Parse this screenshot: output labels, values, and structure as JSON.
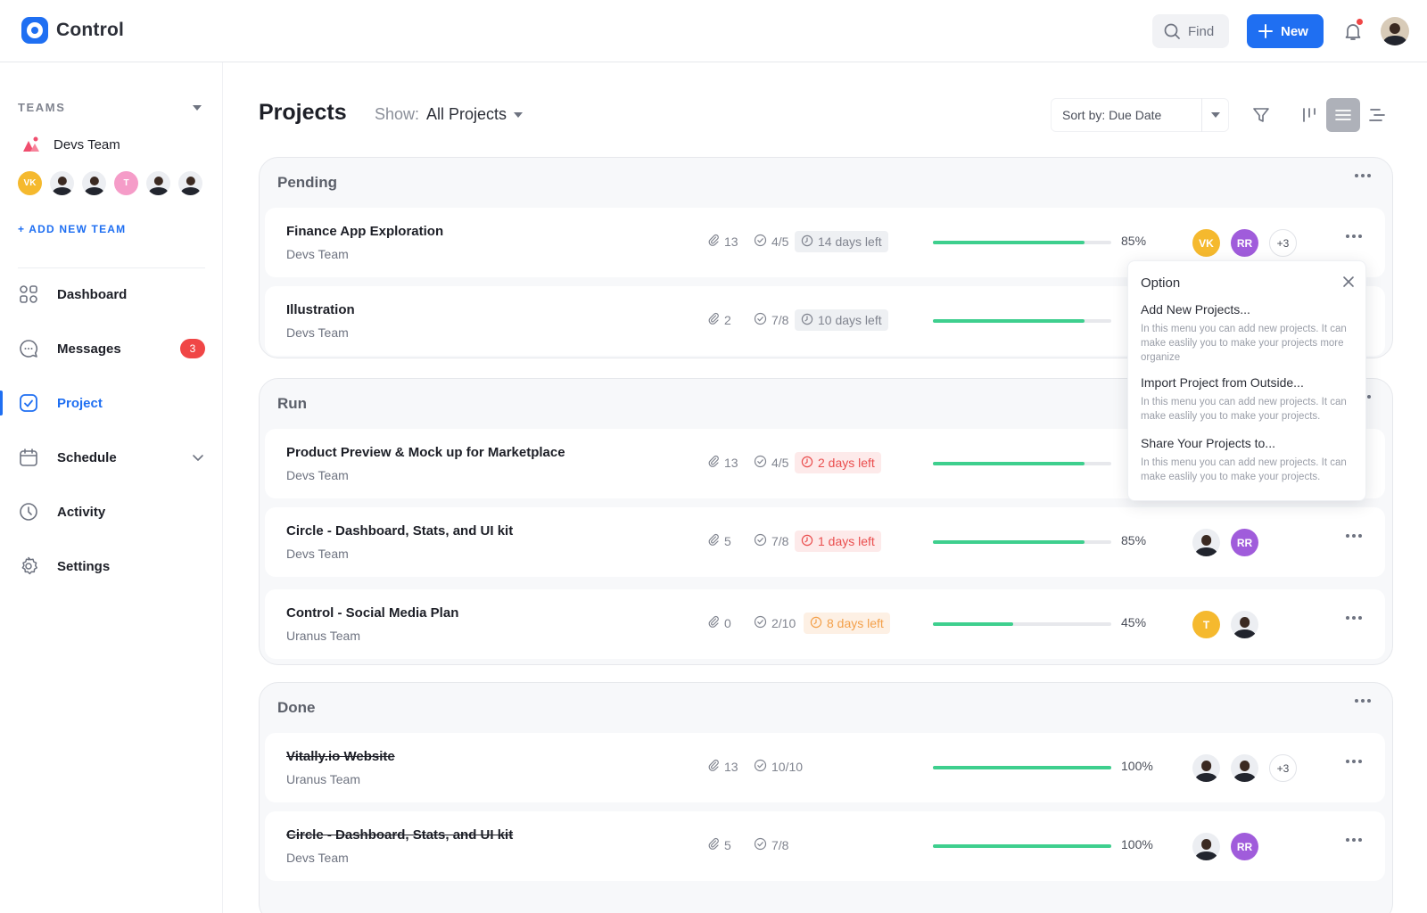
{
  "app": {
    "name": "Control"
  },
  "topbar": {
    "find_label": "Find",
    "new_label": "New"
  },
  "sidebar": {
    "teams_label": "TEAMS",
    "team_name": "Devs Team",
    "team_avatars": [
      {
        "type": "initials",
        "text": "VK",
        "color": "#f5b92e"
      },
      {
        "type": "photo"
      },
      {
        "type": "photo"
      },
      {
        "type": "initials",
        "text": "T",
        "color": "#f59cc8"
      },
      {
        "type": "photo"
      },
      {
        "type": "photo"
      }
    ],
    "add_team_label": "+ ADD NEW TEAM",
    "nav": [
      {
        "label": "Dashboard",
        "icon": "dashboard-icon"
      },
      {
        "label": "Messages",
        "icon": "chat-icon",
        "badge": "3"
      },
      {
        "label": "Project",
        "icon": "check-square-icon",
        "active": true
      },
      {
        "label": "Schedule",
        "icon": "calendar-icon",
        "has_chevron": true
      },
      {
        "label": "Activity",
        "icon": "clock-icon"
      },
      {
        "label": "Settings",
        "icon": "gear-icon"
      }
    ]
  },
  "main": {
    "title": "Projects",
    "show_label": "Show:",
    "show_value": "All Projects",
    "sort_label": "Sort by:",
    "sort_value": "Due Date"
  },
  "colors": {
    "accent": "#1f6ff2",
    "progress": "#3ecf8e",
    "danger": "#f04646",
    "avatar_vk": "#f5b92e",
    "avatar_rr": "#a05cdb",
    "avatar_t": "#f5b92e"
  },
  "sections": [
    {
      "title": "Pending",
      "rows": [
        {
          "title": "Finance App Exploration",
          "team": "Devs Team",
          "attachments": "13",
          "tasks": "4/5",
          "deadline": "14 days left",
          "deadline_style": "gray",
          "progress": 0.85,
          "percent": "85%",
          "avatars": [
            "VK",
            "RR",
            "+3"
          ],
          "done": false
        },
        {
          "title": "Illustration",
          "team": "Devs Team",
          "attachments": "2",
          "tasks": "7/8",
          "deadline": "10 days left",
          "deadline_style": "gray",
          "progress": 0.85,
          "percent": "",
          "avatars": [],
          "done": false
        }
      ]
    },
    {
      "title": "Run",
      "rows": [
        {
          "title": "Product Preview & Mock up for Marketplace",
          "team": "Devs Team",
          "attachments": "13",
          "tasks": "4/5",
          "deadline": "2 days left",
          "deadline_style": "red",
          "progress": 0.85,
          "percent": "",
          "avatars": [],
          "done": false
        },
        {
          "title": "Circle - Dashboard, Stats, and UI kit",
          "team": "Devs Team",
          "attachments": "5",
          "tasks": "7/8",
          "deadline": "1 days left",
          "deadline_style": "red",
          "progress": 0.85,
          "percent": "85%",
          "avatars": [
            "photo",
            "RR"
          ],
          "done": false
        },
        {
          "title": "Control - Social Media Plan",
          "team": "Uranus Team",
          "attachments": "0",
          "tasks": "2/10",
          "deadline": "8 days left",
          "deadline_style": "orange",
          "progress": 0.45,
          "percent": "45%",
          "avatars": [
            "T",
            "photo"
          ],
          "done": false
        }
      ]
    },
    {
      "title": "Done",
      "rows": [
        {
          "title": "Vitally.io Website",
          "team": "Uranus Team",
          "attachments": "13",
          "tasks": "10/10",
          "deadline": "",
          "deadline_style": "",
          "progress": 1.0,
          "percent": "100%",
          "avatars": [
            "photo",
            "photo",
            "+3"
          ],
          "done": true
        },
        {
          "title": "Circle - Dashboard, Stats, and UI kit",
          "team": "Devs Team",
          "attachments": "5",
          "tasks": "7/8",
          "deadline": "",
          "deadline_style": "",
          "progress": 1.0,
          "percent": "100%",
          "avatars": [
            "photo",
            "RR"
          ],
          "done": true
        }
      ]
    }
  ],
  "popup": {
    "title": "Option",
    "items": [
      {
        "title": "Add New Projects...",
        "desc": "In this menu you can add new projects. It can make easlily you to make your projects more organize"
      },
      {
        "title": "Import Project from Outside...",
        "desc": "In this menu you can add new projects. It can make easlily you to make your projects."
      },
      {
        "title": "Share Your Projects to...",
        "desc": "In this menu you can add new projects. It can make easlily you to make your projects."
      }
    ]
  }
}
